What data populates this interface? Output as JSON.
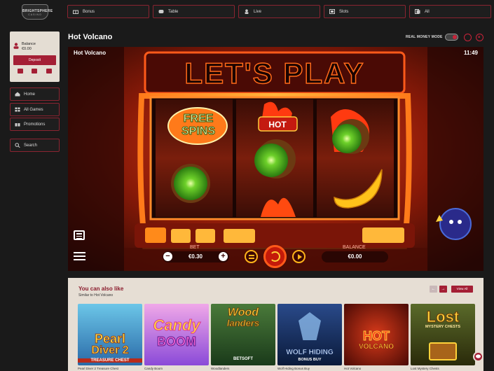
{
  "logo": {
    "line1": "BRIGHTSPHERE",
    "line2": "CASINO"
  },
  "topnav": [
    {
      "label": "Bonus",
      "icon": "bonus-icon"
    },
    {
      "label": "Table",
      "icon": "table-icon"
    },
    {
      "label": "Live",
      "icon": "live-icon"
    },
    {
      "label": "Slots",
      "icon": "slots-icon"
    },
    {
      "label": "All",
      "icon": "all-icon"
    }
  ],
  "sidebar": {
    "balance_label": "Balance",
    "balance_value": "€0.00",
    "deposit_label": "Deposit",
    "items": [
      {
        "label": "Home",
        "icon": "home-icon"
      },
      {
        "label": "All Games",
        "icon": "grid-icon"
      },
      {
        "label": "Promotions",
        "icon": "gift-icon"
      }
    ],
    "search_label": "Search"
  },
  "header": {
    "title": "Hot Volcano",
    "real_money_label": "REAL MONEY MODE"
  },
  "game": {
    "label": "Hot Volcano",
    "time": "11:49",
    "marquee": "LET'S PLAY",
    "bet_label": "BET",
    "bet_value": "€0.30",
    "balance_label": "BALANCE",
    "balance_value": "€0.00",
    "symbols": {
      "free": "FREE",
      "spins": "SPINS",
      "hot": "HOT"
    }
  },
  "also": {
    "title": "You can also like",
    "subtitle": "Similar to Hot Volcano",
    "view_all": "View All",
    "games": [
      {
        "name": "Pearl Diver 2 Treasure Chest",
        "art1": "Pearl",
        "art2": "Diver 2",
        "art3": "TREASURE CHEST",
        "bg": "#4aa3c8"
      },
      {
        "name": "Candy Boom",
        "art1": "Candy",
        "art2": "BOOM",
        "art3": "",
        "bg": "#c07ad8"
      },
      {
        "name": "Woodlanders",
        "art1": "Wood",
        "art2": "landers",
        "art3": "BETSOFT",
        "bg": "#2e5a2a"
      },
      {
        "name": "Wolf Hiding Bonus Buy",
        "art1": "WOLF HIDING",
        "art2": "BONUS BUY",
        "art3": "",
        "bg": "#1d3a6a"
      },
      {
        "name": "Hot Volcano",
        "art1": "HOT",
        "art2": "VOLCANO",
        "art3": "",
        "bg": "#8a1010"
      },
      {
        "name": "Lost Mystery Chests",
        "art1": "Lost",
        "art2": "MYSTERY CHESTS",
        "art3": "",
        "bg": "#3b4a1a"
      }
    ]
  },
  "colors": {
    "accent": "#a41f35",
    "background": "#1a1a1a",
    "card": "#e6ded4"
  }
}
